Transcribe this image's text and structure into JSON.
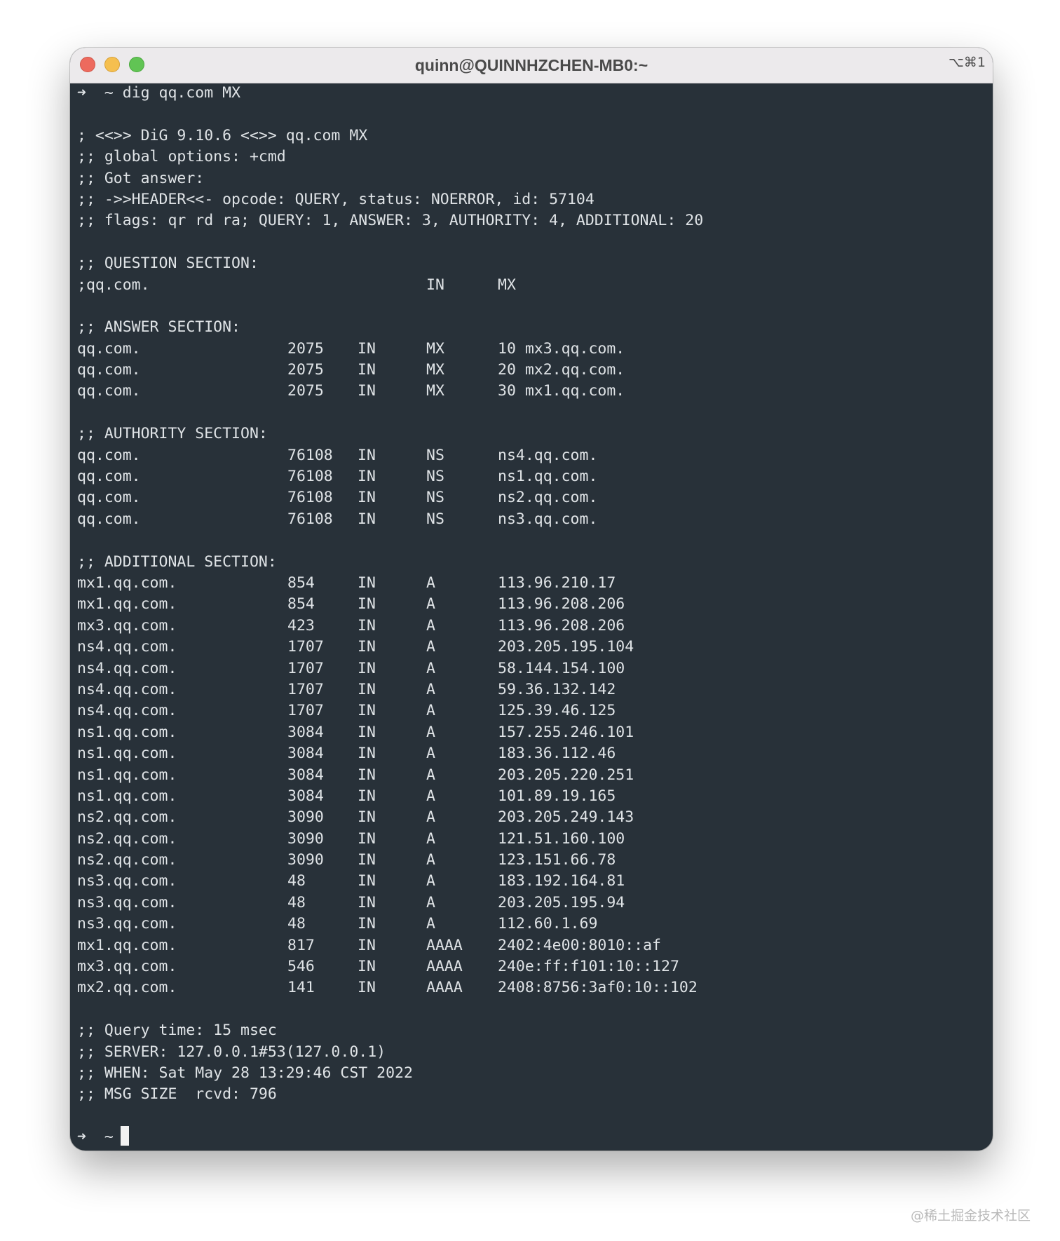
{
  "window": {
    "title": "quinn@QUINNHZCHEN-MB0:~",
    "shortcut": "⌥⌘1",
    "traffic_lights": {
      "close": "#ed6a5e",
      "minimize": "#f5bf4f",
      "zoom": "#61c454"
    }
  },
  "terminal": {
    "background": "#283139",
    "prompt_arrow": "➜",
    "prompt_dir": "~",
    "command": "dig qq.com MX",
    "header_lines": [
      "; <<>> DiG 9.10.6 <<>> qq.com MX",
      ";; global options: +cmd",
      ";; Got answer:",
      ";; ->>HEADER<<- opcode: QUERY, status: NOERROR, id: 57104",
      ";; flags: qr rd ra; QUERY: 1, ANSWER: 3, AUTHORITY: 4, ADDITIONAL: 20"
    ],
    "question_title": ";; QUESTION SECTION:",
    "question": {
      "name": ";qq.com.",
      "class": "IN",
      "type": "MX"
    },
    "answer_title": ";; ANSWER SECTION:",
    "answer": [
      {
        "name": "qq.com.",
        "ttl": "2075",
        "class": "IN",
        "type": "MX",
        "data": "10 mx3.qq.com."
      },
      {
        "name": "qq.com.",
        "ttl": "2075",
        "class": "IN",
        "type": "MX",
        "data": "20 mx2.qq.com."
      },
      {
        "name": "qq.com.",
        "ttl": "2075",
        "class": "IN",
        "type": "MX",
        "data": "30 mx1.qq.com."
      }
    ],
    "authority_title": ";; AUTHORITY SECTION:",
    "authority": [
      {
        "name": "qq.com.",
        "ttl": "76108",
        "class": "IN",
        "type": "NS",
        "data": "ns4.qq.com."
      },
      {
        "name": "qq.com.",
        "ttl": "76108",
        "class": "IN",
        "type": "NS",
        "data": "ns1.qq.com."
      },
      {
        "name": "qq.com.",
        "ttl": "76108",
        "class": "IN",
        "type": "NS",
        "data": "ns2.qq.com."
      },
      {
        "name": "qq.com.",
        "ttl": "76108",
        "class": "IN",
        "type": "NS",
        "data": "ns3.qq.com."
      }
    ],
    "additional_title": ";; ADDITIONAL SECTION:",
    "additional": [
      {
        "name": "mx1.qq.com.",
        "ttl": "854",
        "class": "IN",
        "type": "A",
        "data": "113.96.210.17"
      },
      {
        "name": "mx1.qq.com.",
        "ttl": "854",
        "class": "IN",
        "type": "A",
        "data": "113.96.208.206"
      },
      {
        "name": "mx3.qq.com.",
        "ttl": "423",
        "class": "IN",
        "type": "A",
        "data": "113.96.208.206"
      },
      {
        "name": "ns4.qq.com.",
        "ttl": "1707",
        "class": "IN",
        "type": "A",
        "data": "203.205.195.104"
      },
      {
        "name": "ns4.qq.com.",
        "ttl": "1707",
        "class": "IN",
        "type": "A",
        "data": "58.144.154.100"
      },
      {
        "name": "ns4.qq.com.",
        "ttl": "1707",
        "class": "IN",
        "type": "A",
        "data": "59.36.132.142"
      },
      {
        "name": "ns4.qq.com.",
        "ttl": "1707",
        "class": "IN",
        "type": "A",
        "data": "125.39.46.125"
      },
      {
        "name": "ns1.qq.com.",
        "ttl": "3084",
        "class": "IN",
        "type": "A",
        "data": "157.255.246.101"
      },
      {
        "name": "ns1.qq.com.",
        "ttl": "3084",
        "class": "IN",
        "type": "A",
        "data": "183.36.112.46"
      },
      {
        "name": "ns1.qq.com.",
        "ttl": "3084",
        "class": "IN",
        "type": "A",
        "data": "203.205.220.251"
      },
      {
        "name": "ns1.qq.com.",
        "ttl": "3084",
        "class": "IN",
        "type": "A",
        "data": "101.89.19.165"
      },
      {
        "name": "ns2.qq.com.",
        "ttl": "3090",
        "class": "IN",
        "type": "A",
        "data": "203.205.249.143"
      },
      {
        "name": "ns2.qq.com.",
        "ttl": "3090",
        "class": "IN",
        "type": "A",
        "data": "121.51.160.100"
      },
      {
        "name": "ns2.qq.com.",
        "ttl": "3090",
        "class": "IN",
        "type": "A",
        "data": "123.151.66.78"
      },
      {
        "name": "ns3.qq.com.",
        "ttl": "48",
        "class": "IN",
        "type": "A",
        "data": "183.192.164.81"
      },
      {
        "name": "ns3.qq.com.",
        "ttl": "48",
        "class": "IN",
        "type": "A",
        "data": "203.205.195.94"
      },
      {
        "name": "ns3.qq.com.",
        "ttl": "48",
        "class": "IN",
        "type": "A",
        "data": "112.60.1.69"
      },
      {
        "name": "mx1.qq.com.",
        "ttl": "817",
        "class": "IN",
        "type": "AAAA",
        "data": "2402:4e00:8010::af"
      },
      {
        "name": "mx3.qq.com.",
        "ttl": "546",
        "class": "IN",
        "type": "AAAA",
        "data": "240e:ff:f101:10::127"
      },
      {
        "name": "mx2.qq.com.",
        "ttl": "141",
        "class": "IN",
        "type": "AAAA",
        "data": "2408:8756:3af0:10::102"
      }
    ],
    "footer_lines": [
      ";; Query time: 15 msec",
      ";; SERVER: 127.0.0.1#53(127.0.0.1)",
      ";; WHEN: Sat May 28 13:29:46 CST 2022",
      ";; MSG SIZE  rcvd: 796"
    ]
  },
  "watermark": "@稀土掘金技术社区"
}
